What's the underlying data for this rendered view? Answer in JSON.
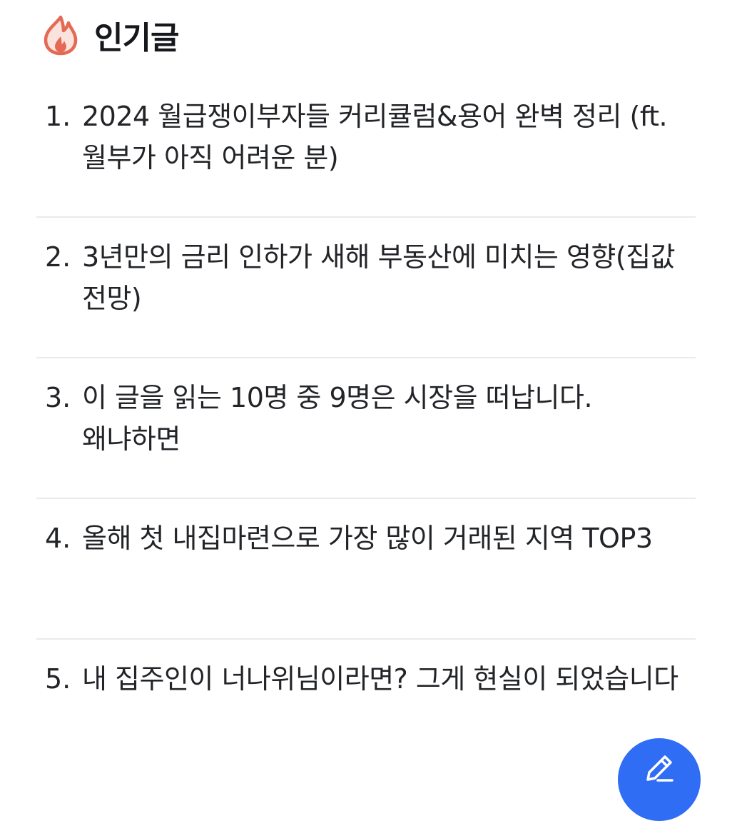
{
  "header": {
    "title": "인기글",
    "icon": "fire-icon",
    "icon_color": "#E46A55"
  },
  "posts": [
    {
      "rank": "1.",
      "title": "2024 월급쟁이부자들 커리큘럼&용어 완벽 정리 (ft. 월부가 아직 어려운 분)"
    },
    {
      "rank": "2.",
      "title": "3년만의 금리 인하가 새해 부동산에 미치는 영향(집값 전망)"
    },
    {
      "rank": "3.",
      "title": "이 글을 읽는 10명 중 9명은 시장을 떠납니다. 왜냐하면"
    },
    {
      "rank": "4.",
      "title": "올해 첫 내집마련으로 가장 많이 거래된 지역 TOP3"
    },
    {
      "rank": "5.",
      "title": "내 집주인이 너나위님이라면? 그게 현실이 되었습니다"
    }
  ],
  "fab": {
    "icon": "pencil-icon",
    "color": "#2F6DF4"
  }
}
